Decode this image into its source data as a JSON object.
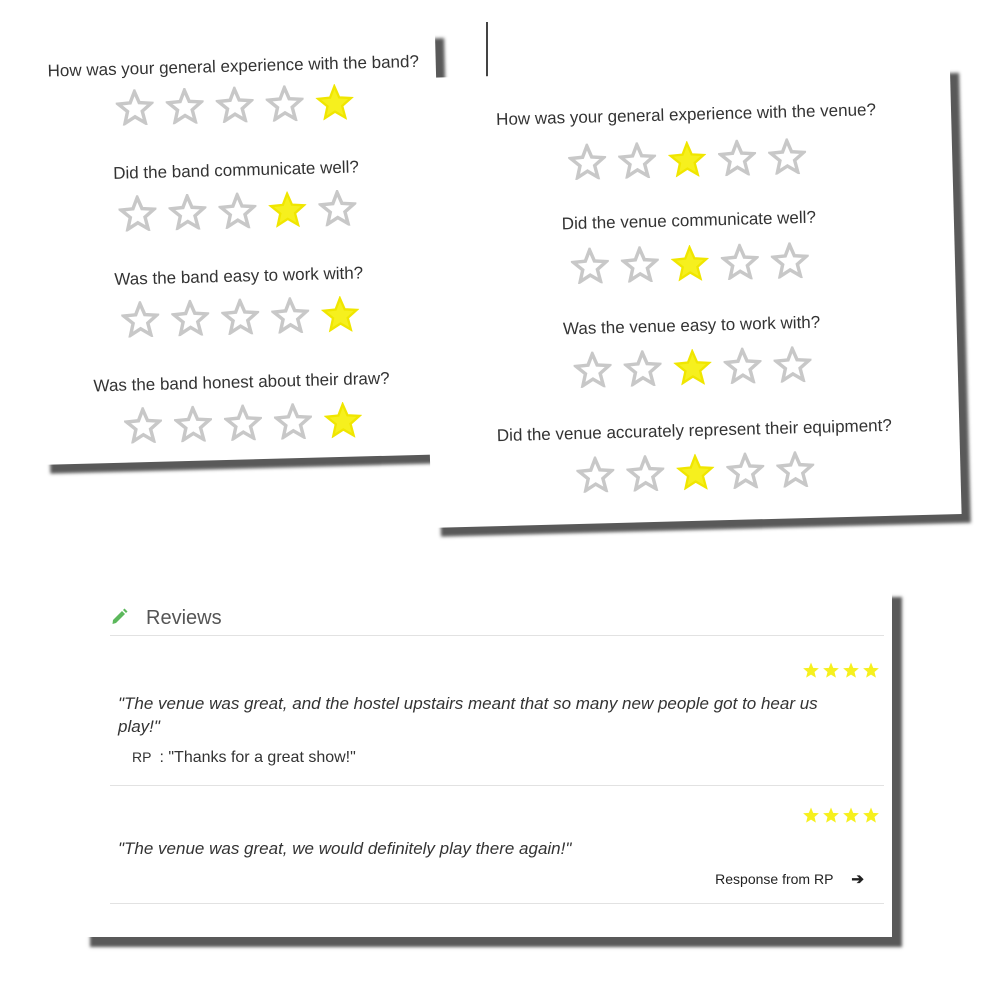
{
  "band_survey": {
    "questions": [
      {
        "text": "How was your general experience with the band?",
        "rating": 5
      },
      {
        "text": "Did the band communicate well?",
        "rating": 4
      },
      {
        "text": "Was the band easy to work with?",
        "rating": 5
      },
      {
        "text": "Was the band honest about their draw?",
        "rating": 5
      }
    ]
  },
  "venue_survey": {
    "questions": [
      {
        "text": "How was your general experience with the venue?",
        "rating": 3
      },
      {
        "text": "Did the venue communicate well?",
        "rating": 3
      },
      {
        "text": "Was the venue easy to work with?",
        "rating": 3
      },
      {
        "text": "Did the venue accurately represent their equipment?",
        "rating": 3
      }
    ],
    "max_rating": 5
  },
  "reviews": {
    "title": "Reviews",
    "icon": "pencil-icon",
    "items": [
      {
        "stars": 4,
        "quote": "\"The venue was great, and the hostel upstairs meant that so many new people got to hear us play!\"",
        "reply_author": "RP",
        "reply_sep": ":",
        "reply_text": "\"Thanks for a great show!\""
      },
      {
        "stars": 4,
        "quote": "\"The venue was great, we would definitely play there again!\"",
        "response_link": "Response from RP"
      }
    ]
  },
  "colors": {
    "star_filled": "#f6f01e",
    "star_empty_stroke": "#c8c8c8",
    "pencil": "#5cb85c"
  }
}
